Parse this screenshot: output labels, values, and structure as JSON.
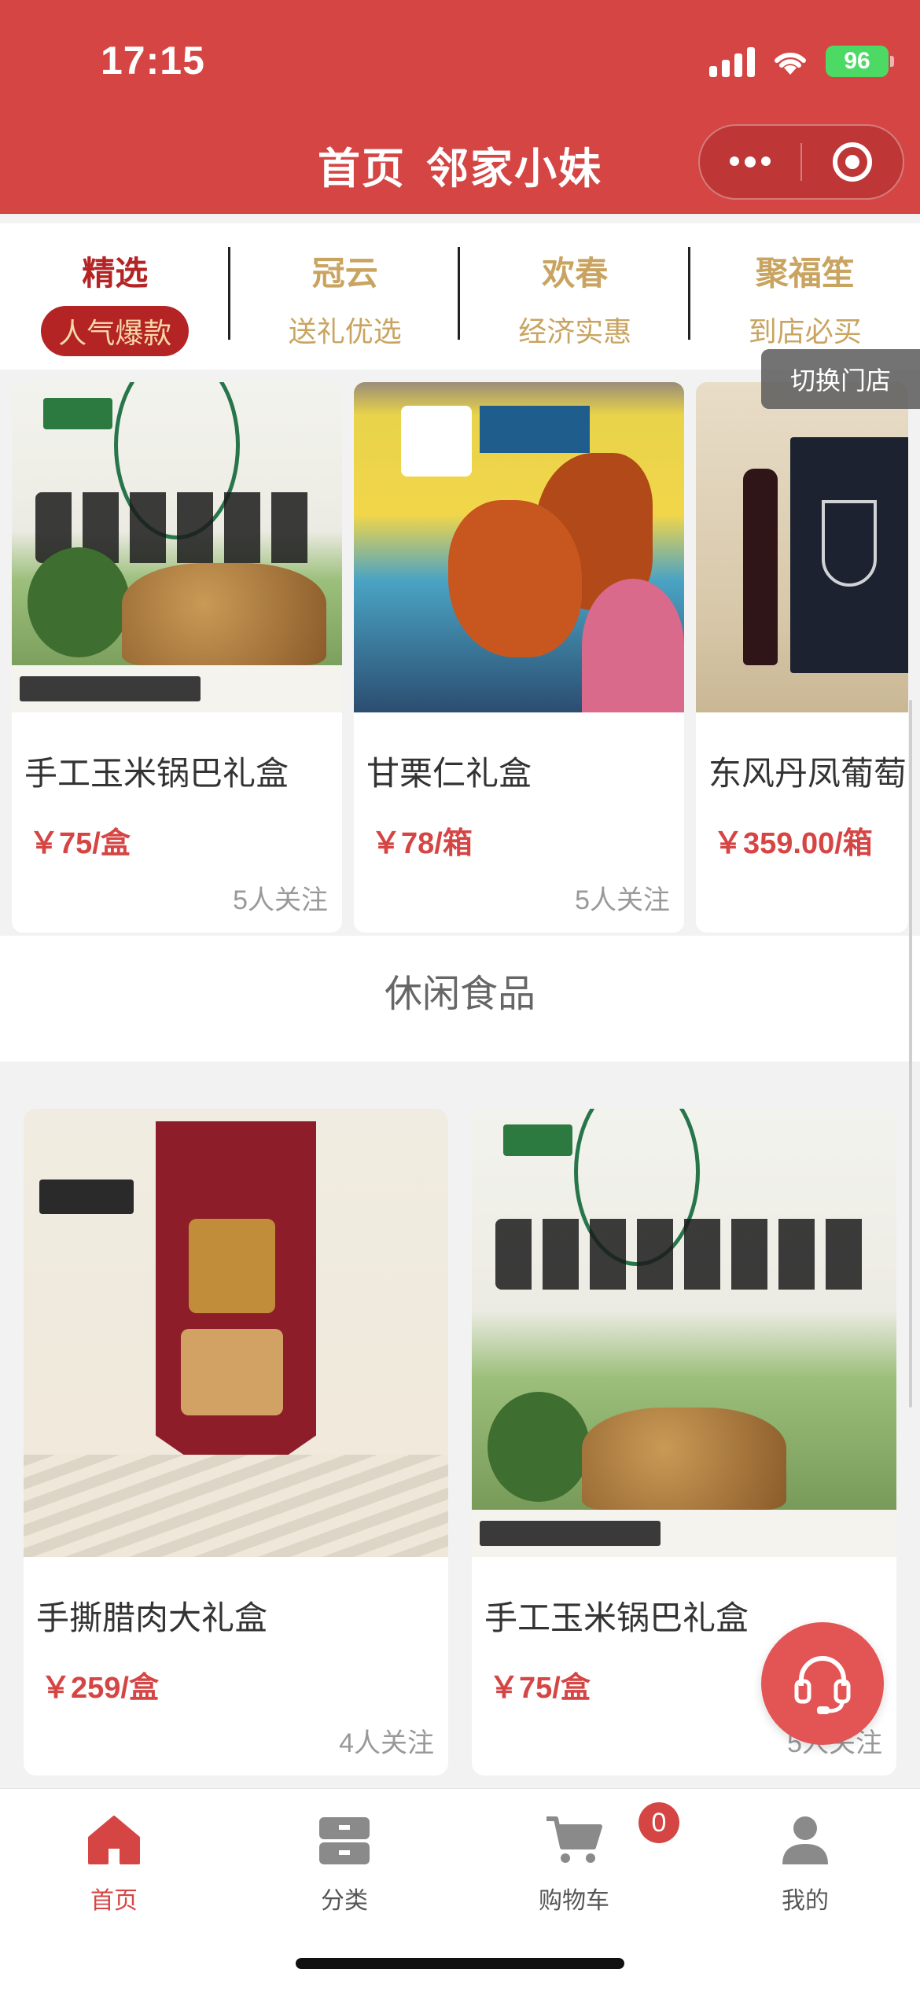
{
  "status_bar": {
    "time": "17:15",
    "battery": "96"
  },
  "nav": {
    "title_home": "首页",
    "title_store": "邻家小妹"
  },
  "tabs": [
    {
      "name": "精选",
      "sub": "人气爆款"
    },
    {
      "name": "冠云",
      "sub": "送礼优选"
    },
    {
      "name": "欢春",
      "sub": "经济实惠"
    },
    {
      "name": "聚福笙",
      "sub": "到店必买"
    }
  ],
  "switch_store_label": "切换门店",
  "featured_products": [
    {
      "name": "手工玉米锅巴礼盒",
      "price": "￥75/盒",
      "follow": "5人关注"
    },
    {
      "name": "甘栗仁礼盒",
      "price": "￥78/箱",
      "follow": "5人关注"
    },
    {
      "name": "东风丹凤葡萄",
      "price": "￥359.00/箱",
      "follow": ""
    }
  ],
  "section": {
    "title": "休闲食品"
  },
  "section_products": [
    {
      "name": "手撕腊肉大礼盒",
      "price": "￥259/盒",
      "follow": "4人关注"
    },
    {
      "name": "手工玉米锅巴礼盒",
      "price": "￥75/盒",
      "follow": "5人关注"
    }
  ],
  "tabbar": [
    {
      "label": "首页",
      "icon": "home-icon"
    },
    {
      "label": "分类",
      "icon": "category-icon"
    },
    {
      "label": "购物车",
      "icon": "cart-icon"
    },
    {
      "label": "我的",
      "icon": "user-icon"
    }
  ],
  "cart_count": "0",
  "colors": {
    "brand_red": "#d54544",
    "tab_gold": "#c9a461",
    "active_red": "#b42424"
  }
}
